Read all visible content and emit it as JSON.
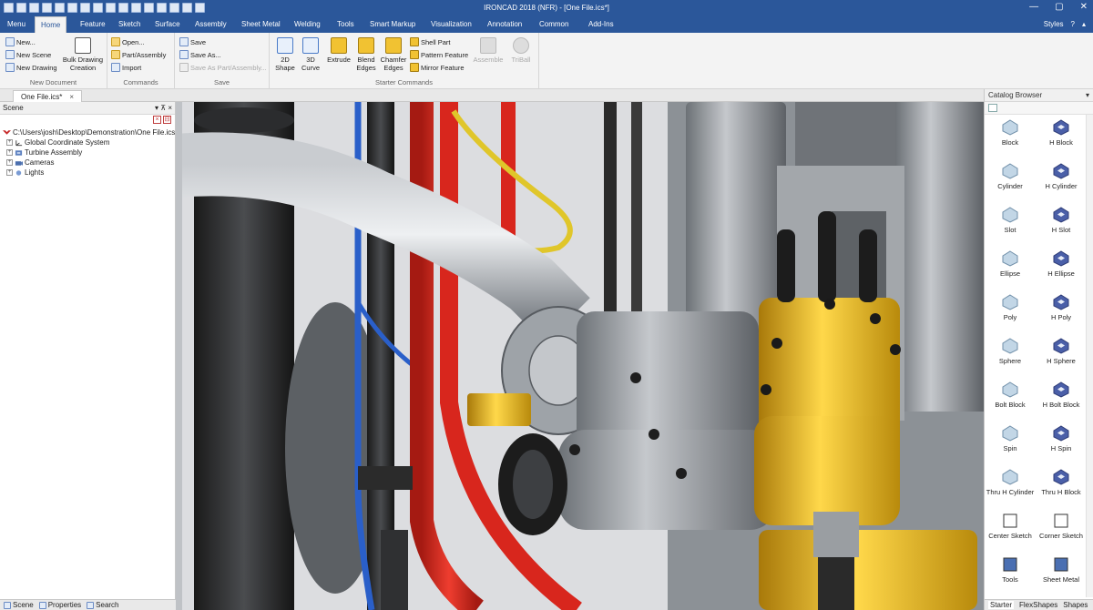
{
  "window": {
    "title": "IRONCAD 2018 (NFR) - [One File.ics*]"
  },
  "menu_tabs": [
    "Menu",
    "Home",
    "Feature",
    "Sketch",
    "Surface",
    "Assembly",
    "Sheet Metal",
    "Welding",
    "Tools",
    "Smart Markup",
    "Visualization",
    "Annotation",
    "Common",
    "Add-Ins"
  ],
  "menu_right": {
    "styles": "Styles",
    "help": "?"
  },
  "ribbon": {
    "new_document": {
      "label": "New Document",
      "new": "New...",
      "new_scene": "New Scene",
      "new_drawing": "New Drawing",
      "bulk_drawing": "Bulk Drawing",
      "creation": "Creation"
    },
    "commands": {
      "label": "Commands",
      "open": "Open...",
      "part_assembly": "Part/Assembly",
      "import": "Import"
    },
    "save": {
      "label": "Save",
      "save": "Save",
      "save_as": "Save As...",
      "save_as_part": "Save As Part/Assembly..."
    },
    "starter": {
      "label": "Starter Commands",
      "shape_2d": "2D",
      "shape_2d_b": "Shape",
      "curve_3d": "3D",
      "curve_3d_b": "Curve",
      "extrude": "Extrude",
      "blend": "Blend",
      "blend_b": "Edges",
      "chamfer": "Chamfer",
      "chamfer_b": "Edges",
      "shell": "Shell Part",
      "pattern": "Pattern Feature",
      "mirror": "Mirror Feature",
      "assemble": "Assemble",
      "triball": "TriBall"
    }
  },
  "doc_tab": {
    "name": "One File.ics*",
    "close": "×"
  },
  "scene": {
    "title": "Scene",
    "controls": "▾ ⊼ ×",
    "tree": [
      {
        "label": "C:\\Users\\josh\\Desktop\\Demonstration\\One File.ics"
      },
      {
        "label": "Global Coordinate System"
      },
      {
        "label": "Turbine Assembly"
      },
      {
        "label": "Cameras"
      },
      {
        "label": "Lights"
      }
    ]
  },
  "bottom_tabs": [
    "Scene",
    "Properties",
    "Search"
  ],
  "catalog": {
    "title": "Catalog Browser",
    "items": [
      {
        "label": "Block",
        "icon": "block-icon"
      },
      {
        "label": "H Block",
        "icon": "h-block-icon"
      },
      {
        "label": "Cylinder",
        "icon": "cylinder-icon"
      },
      {
        "label": "H Cylinder",
        "icon": "h-cylinder-icon"
      },
      {
        "label": "Slot",
        "icon": "slot-icon"
      },
      {
        "label": "H Slot",
        "icon": "h-slot-icon"
      },
      {
        "label": "Ellipse",
        "icon": "ellipse-icon"
      },
      {
        "label": "H Ellipse",
        "icon": "h-ellipse-icon"
      },
      {
        "label": "Poly",
        "icon": "poly-icon"
      },
      {
        "label": "H Poly",
        "icon": "h-poly-icon"
      },
      {
        "label": "Sphere",
        "icon": "sphere-icon"
      },
      {
        "label": "H Sphere",
        "icon": "h-sphere-icon"
      },
      {
        "label": "Bolt Block",
        "icon": "bolt-block-icon"
      },
      {
        "label": "H Bolt Block",
        "icon": "h-bolt-block-icon"
      },
      {
        "label": "Spin",
        "icon": "spin-icon"
      },
      {
        "label": "H Spin",
        "icon": "h-spin-icon"
      },
      {
        "label": "Thru H Cylinder",
        "icon": "thru-h-cylinder-icon"
      },
      {
        "label": "Thru H Block",
        "icon": "thru-h-block-icon"
      },
      {
        "label": "Center Sketch",
        "icon": "center-sketch-icon"
      },
      {
        "label": "Corner Sketch",
        "icon": "corner-sketch-icon"
      },
      {
        "label": "Tools",
        "icon": "tools-icon"
      },
      {
        "label": "Sheet Metal",
        "icon": "sheet-metal-icon"
      }
    ],
    "tabs": [
      "Starter",
      "FlexShapes",
      "Shapes"
    ]
  },
  "colors": {
    "titlebar": "#2b579a",
    "yellow_part": "#e8b214",
    "red_hose": "#d8261d",
    "blue_wire": "#2a5fc9",
    "steel": "#9ea3a8"
  }
}
